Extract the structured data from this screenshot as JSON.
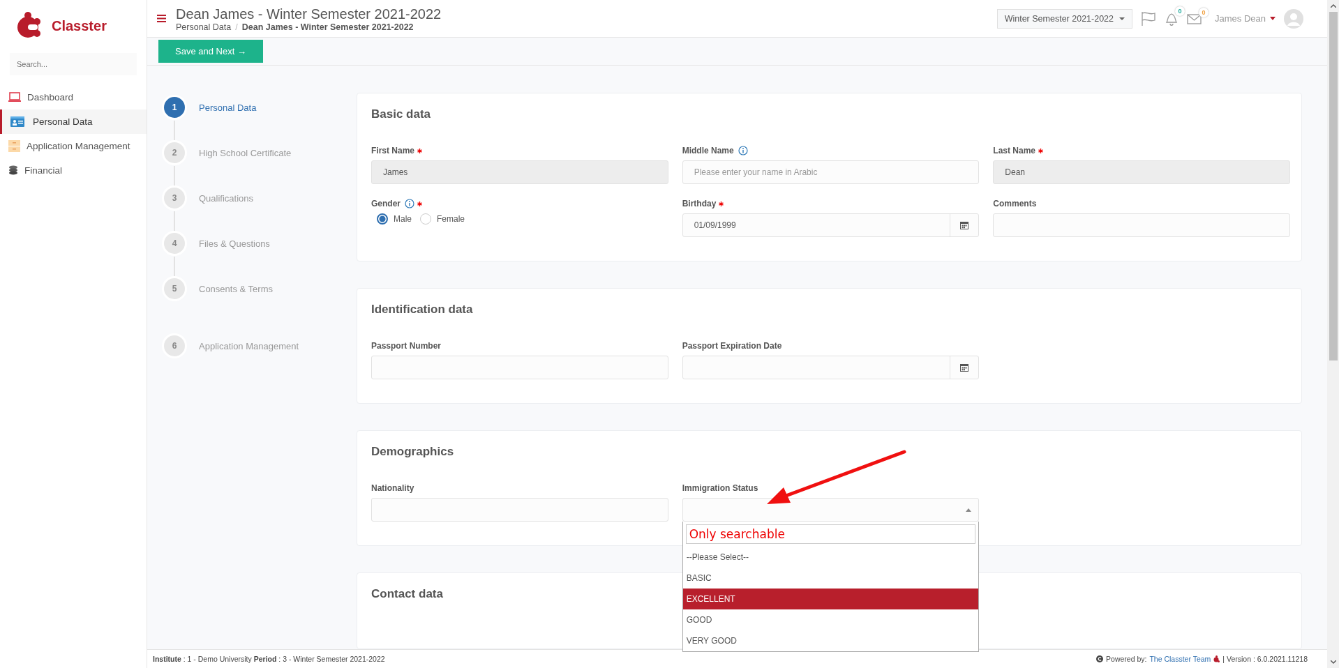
{
  "app": {
    "name": "Classter",
    "search_placeholder": "Search..."
  },
  "sidebar": {
    "items": [
      {
        "label": "Dashboard",
        "selected": false
      },
      {
        "label": "Personal Data",
        "selected": true
      },
      {
        "label": "Application Management",
        "selected": false
      },
      {
        "label": "Financial",
        "selected": false
      }
    ]
  },
  "header": {
    "title": "Dean James - Winter Semester 2021-2022",
    "breadcrumb": [
      "Personal Data",
      "Dean James - Winter Semester 2021-2022"
    ],
    "breadcrumb_separator": "/",
    "semester": "Winter Semester 2021-2022",
    "notifications": "0",
    "messages": "0",
    "user": "James Dean"
  },
  "toolbar": {
    "save_button": "Save and Next →"
  },
  "steps": [
    {
      "number": "1",
      "label": "Personal Data",
      "selected": true
    },
    {
      "number": "2",
      "label": "High School Certificate",
      "selected": false
    },
    {
      "number": "3",
      "label": "Qualifications",
      "selected": false
    },
    {
      "number": "4",
      "label": "Files & Questions",
      "selected": false
    },
    {
      "number": "5",
      "label": "Consents & Terms",
      "selected": false
    }
  ],
  "extra_step": {
    "number": "6",
    "label": "Application Management",
    "selected": false
  },
  "sections": [
    {
      "title": "Basic data",
      "fields": [
        {
          "kind": "text",
          "label": "First Name",
          "required": true,
          "info": false,
          "value": "James",
          "disabled": true
        },
        {
          "kind": "text",
          "label": "Middle Name",
          "required": false,
          "info": true,
          "placeholder": "Please enter your name in Arabic",
          "disabled": false
        },
        {
          "kind": "text",
          "label": "Last Name",
          "required": true,
          "info": false,
          "value": "Dean",
          "disabled": true
        },
        {
          "kind": "radio",
          "label": "Gender",
          "required": true,
          "info": true,
          "options": [
            {
              "label": "Male",
              "selected": true
            },
            {
              "label": "Female",
              "selected": false
            }
          ]
        },
        {
          "kind": "date",
          "label": "Birthday",
          "required": true,
          "info": false,
          "value": "01/09/1999"
        },
        {
          "kind": "text",
          "label": "Comments",
          "required": false,
          "info": false,
          "disabled": false
        }
      ]
    },
    {
      "title": "Identification data",
      "fields": [
        {
          "kind": "text",
          "label": "Passport Number",
          "required": false,
          "info": false,
          "disabled": false
        },
        {
          "kind": "date",
          "label": "Passport Expiration Date",
          "required": false,
          "info": false
        }
      ]
    },
    {
      "title": "Demographics",
      "fields": [
        {
          "kind": "text",
          "label": "Nationality",
          "required": false,
          "info": false,
          "disabled": false
        },
        {
          "kind": "select",
          "label": "Immigration Status",
          "required": false,
          "info": false,
          "open": true,
          "search_value": "Only searchable",
          "options": [
            {
              "label": "--Please Select--",
              "selected": false
            },
            {
              "label": "BASIC",
              "selected": false
            },
            {
              "label": "EXCELLENT",
              "selected": true
            },
            {
              "label": "GOOD",
              "selected": false
            },
            {
              "label": "VERY GOOD",
              "selected": false
            }
          ]
        }
      ]
    },
    {
      "title": "Contact data"
    }
  ],
  "footer": {
    "info": "**Institute** : 1 - Demo University **Period** : 3 - Winter Semester 2021-2022",
    "powered_by": "Powered by:",
    "team_link": "The Classter Team",
    "version": "| Version : 6.0.2021.11218"
  }
}
